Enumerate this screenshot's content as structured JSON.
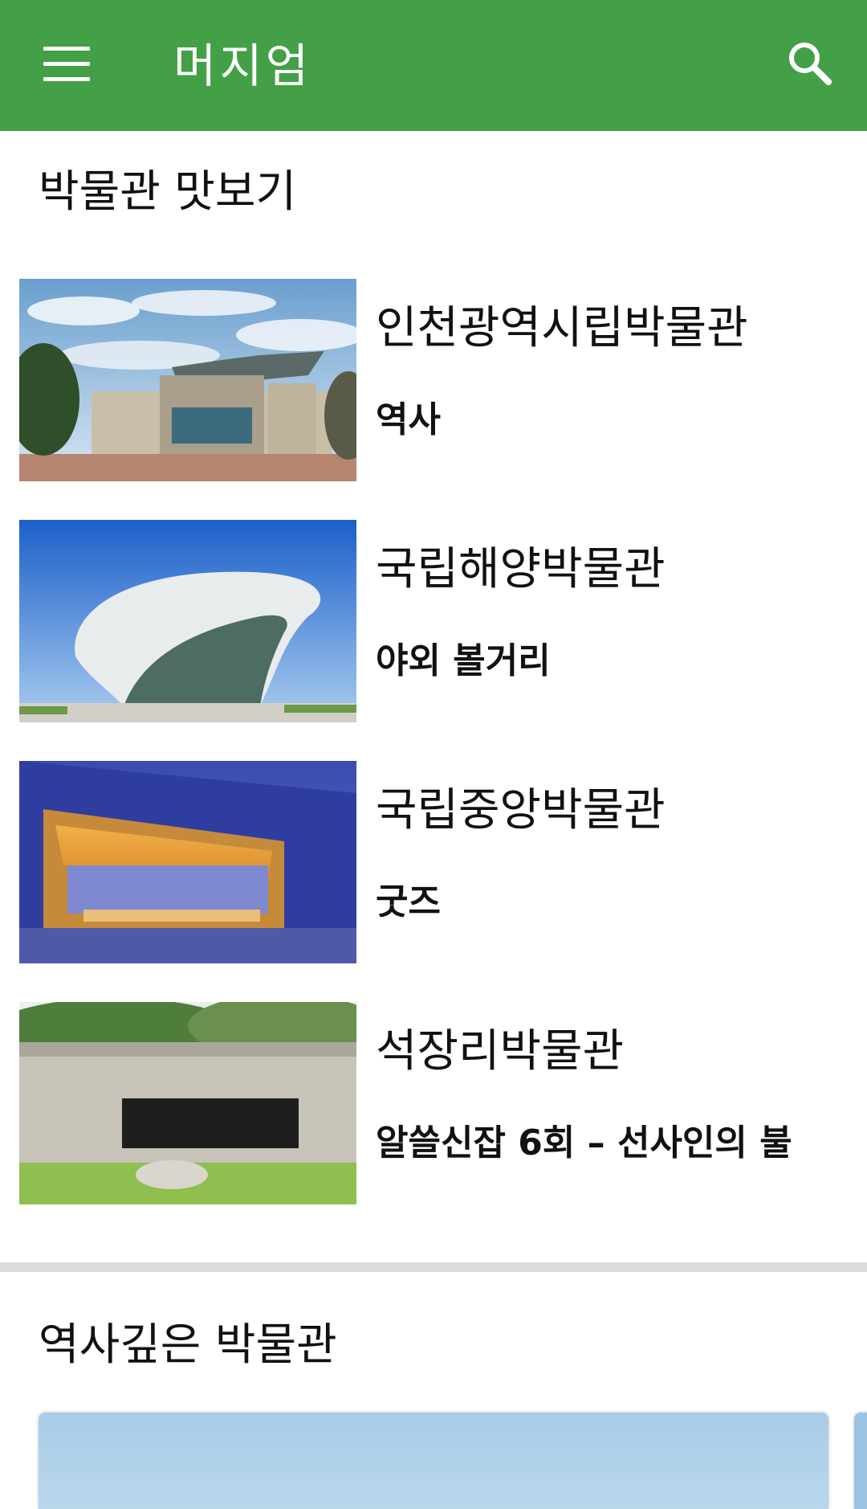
{
  "app_bar": {
    "title": "머지엄",
    "menu_icon": "hamburger-menu-icon",
    "search_icon": "search-icon",
    "color": "#43a047"
  },
  "section1": {
    "title": "박물관 맛보기",
    "items": [
      {
        "name": "인천광역시립박물관",
        "sub": "역사",
        "image": "museum-building-cloudy-sky"
      },
      {
        "name": "국립해양박물관",
        "sub": "야외 볼거리",
        "image": "curved-glass-museum-blue-sky"
      },
      {
        "name": "국립중앙박물관",
        "sub": "굿즈",
        "image": "museum-gate-at-dusk"
      },
      {
        "name": "석장리박물관",
        "sub": "알쓸신잡 6회 – 선사인의 불",
        "image": "stone-wall-sign"
      }
    ]
  },
  "section2": {
    "title": "역사깊은 박물관"
  }
}
